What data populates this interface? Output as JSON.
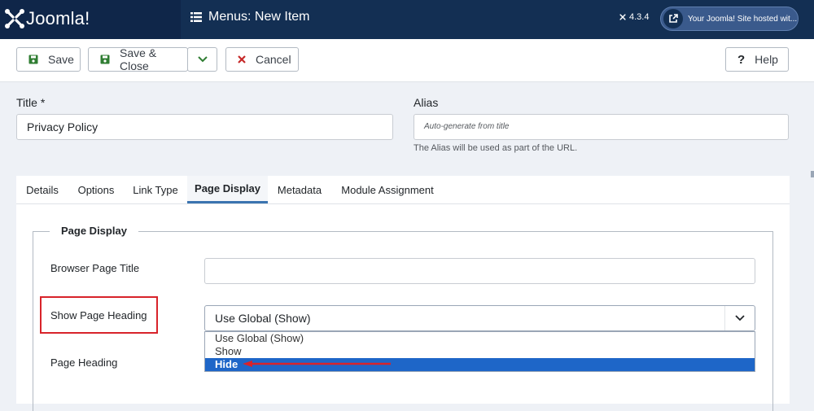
{
  "topbar": {
    "brand_name": "Joomla!",
    "page_title": "Menus: New Item",
    "version": "4.3.4",
    "site_link": "Your Joomla! Site hosted wit..."
  },
  "toolbar": {
    "save_label": "Save",
    "save_close_label": "Save & Close",
    "cancel_label": "Cancel",
    "help_label": "Help"
  },
  "form": {
    "title_label": "Title *",
    "title_value": "Privacy Policy",
    "alias_label": "Alias",
    "alias_placeholder": "Auto-generate from title",
    "alias_help": "The Alias will be used as part of the URL."
  },
  "tabs": [
    {
      "label": "Details"
    },
    {
      "label": "Options"
    },
    {
      "label": "Link Type"
    },
    {
      "label": "Page Display"
    },
    {
      "label": "Metadata"
    },
    {
      "label": "Module Assignment"
    }
  ],
  "page_display": {
    "legend": "Page Display",
    "browser_title_label": "Browser Page Title",
    "browser_title_value": "",
    "show_heading_label": "Show Page Heading",
    "show_heading_value": "Use Global (Show)",
    "options": [
      "Use Global (Show)",
      "Show",
      "Hide"
    ],
    "highlighted_option": "Hide",
    "page_heading_label": "Page Heading"
  },
  "colors": {
    "topbar": "#132f53",
    "accent": "#1e66c8",
    "annotation": "#d8232a"
  }
}
